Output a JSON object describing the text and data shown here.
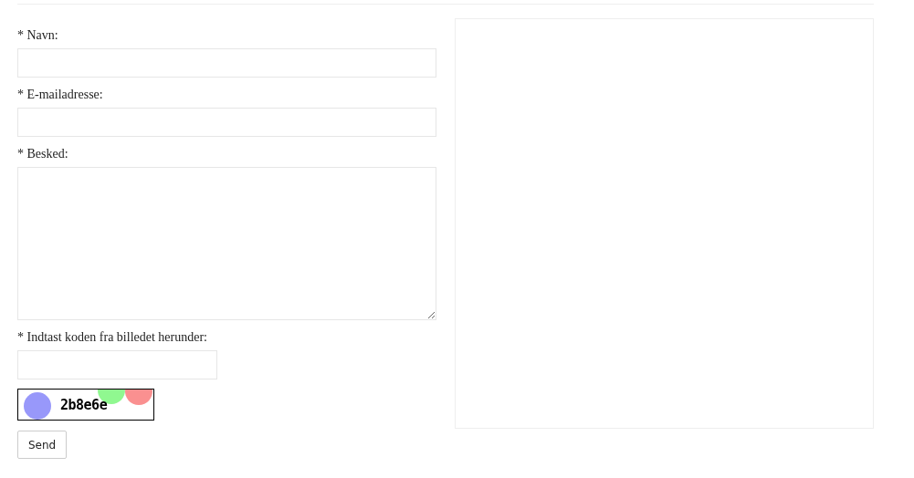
{
  "form": {
    "fields": [
      {
        "kind": "text",
        "label": "* Navn:"
      },
      {
        "kind": "text",
        "label": "* E-mailadresse:"
      },
      {
        "kind": "textarea",
        "label": "* Besked:"
      },
      {
        "kind": "short",
        "label": "* Indtast koden fra billedet herunder:"
      }
    ],
    "captcha": {
      "code": "2b8e6e"
    },
    "submit": "Send"
  }
}
